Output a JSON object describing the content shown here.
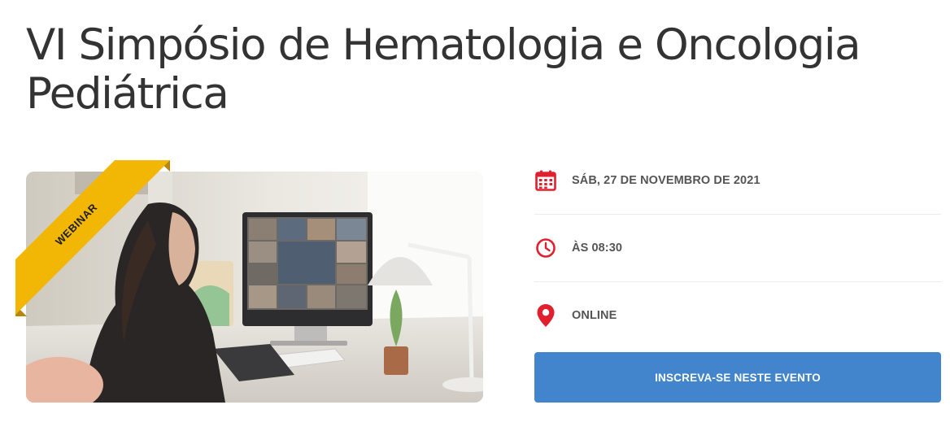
{
  "event": {
    "title": "VI Simpósio de Hematologia e Oncologia Pediátrica",
    "badge": "WEBINAR",
    "date": "SÁB, 27 DE NOVEMBRO DE 2021",
    "time": "ÀS 08:30",
    "location": "ONLINE",
    "register_label": "INSCREVA-SE NESTE EVENTO"
  },
  "icons": {
    "date": "calendar-icon",
    "time": "clock-icon",
    "location": "map-pin-icon"
  },
  "colors": {
    "title": "#333333",
    "icon_red": "#e0202f",
    "ribbon_yellow": "#f2b705",
    "button_blue": "#4285cc",
    "info_text": "#555555"
  }
}
